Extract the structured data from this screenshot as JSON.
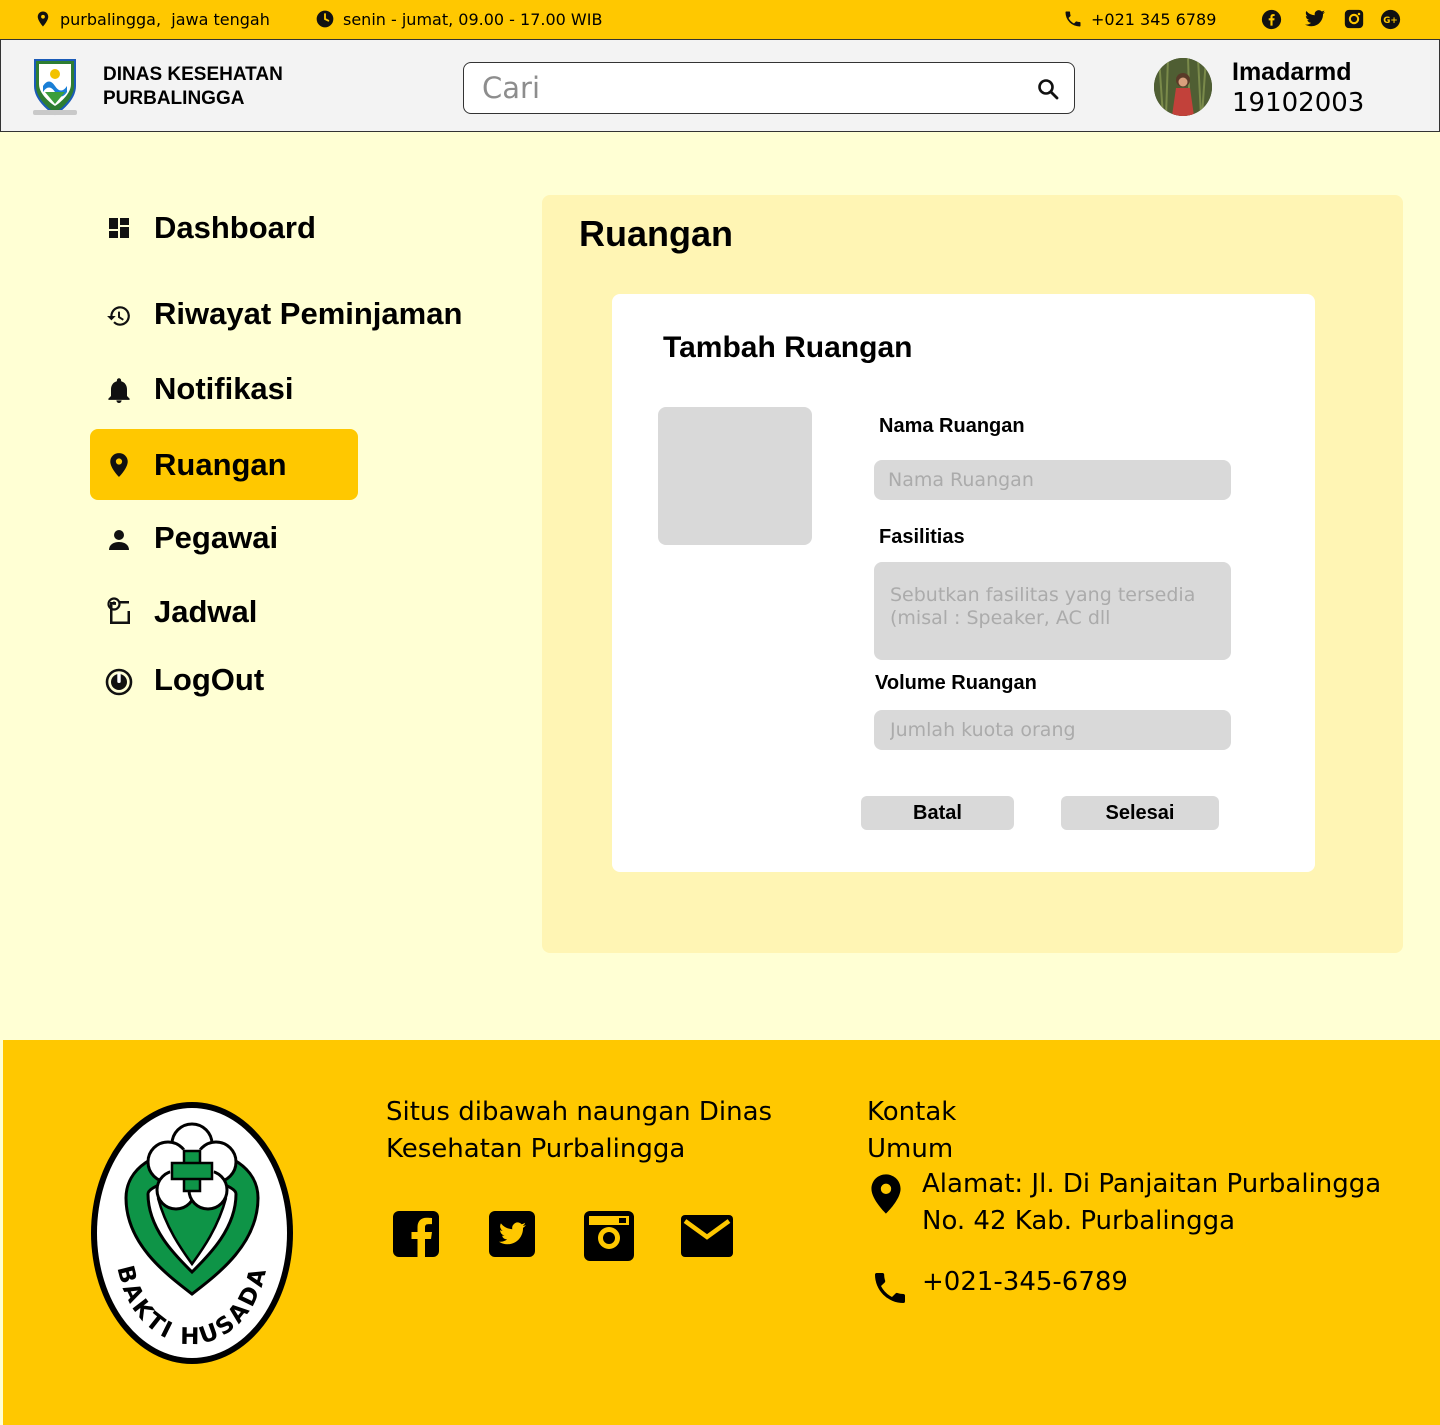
{
  "topbar": {
    "location": "purbalingga,  jawa tengah",
    "hours": "senin - jumat, 09.00 - 17.00 WIB",
    "phone": "+021 345 6789",
    "social_icons": [
      "facebook-icon",
      "twitter-icon",
      "instagram-icon",
      "google-plus-icon"
    ]
  },
  "header": {
    "org_line1": "DINAS KESEHATAN",
    "org_line2": "PURBALINGGA",
    "search_placeholder": "Cari",
    "user_name": "Imadarmd",
    "user_id": "19102003"
  },
  "sidebar": {
    "items": [
      {
        "label": "Dashboard",
        "icon": "dashboard-icon",
        "active": false
      },
      {
        "label": "Riwayat Peminjaman",
        "icon": "history-icon",
        "active": false
      },
      {
        "label": "Notifikasi",
        "icon": "bell-icon",
        "active": false
      },
      {
        "label": "Ruangan",
        "icon": "location-pin-icon",
        "active": true
      },
      {
        "label": "Pegawai",
        "icon": "person-icon",
        "active": false
      },
      {
        "label": "Jadwal",
        "icon": "schedule-icon",
        "active": false
      },
      {
        "label": "LogOut",
        "icon": "power-icon",
        "active": false
      }
    ]
  },
  "main": {
    "title": "Ruangan",
    "form": {
      "title": "Tambah Ruangan",
      "name_label": "Nama Ruangan",
      "name_placeholder": "Nama Ruangan",
      "facilities_label": "Fasilitias",
      "facilities_placeholder": "Sebutkan fasilitas yang tersedia (misal : Speaker, AC dll",
      "volume_label": "Volume Ruangan",
      "volume_placeholder": "Jumlah kuota orang",
      "cancel_label": "Batal",
      "submit_label": "Selesai"
    }
  },
  "footer": {
    "emblem_text": "BAKTI HUSADA",
    "about_line1": "Situs dibawah naungan Dinas",
    "about_line2": "Kesehatan Purbalingga",
    "social_icons": [
      "facebook-icon",
      "twitter-icon",
      "instagram-icon",
      "mail-icon"
    ],
    "contact_title_line1": "Kontak",
    "contact_title_line2": "Umum",
    "address_line1": "Alamat: Jl. Di Panjaitan Purbalingga",
    "address_line2": "No. 42 Kab. Purbalingga",
    "phone": "+021-345-6789"
  },
  "colors": {
    "accent": "#FFC800",
    "page_bg": "#FFFFD4",
    "panel_bg": "#FFF5B4",
    "input_bg": "#D9D9D9",
    "emblem_green": "#0E9447"
  }
}
